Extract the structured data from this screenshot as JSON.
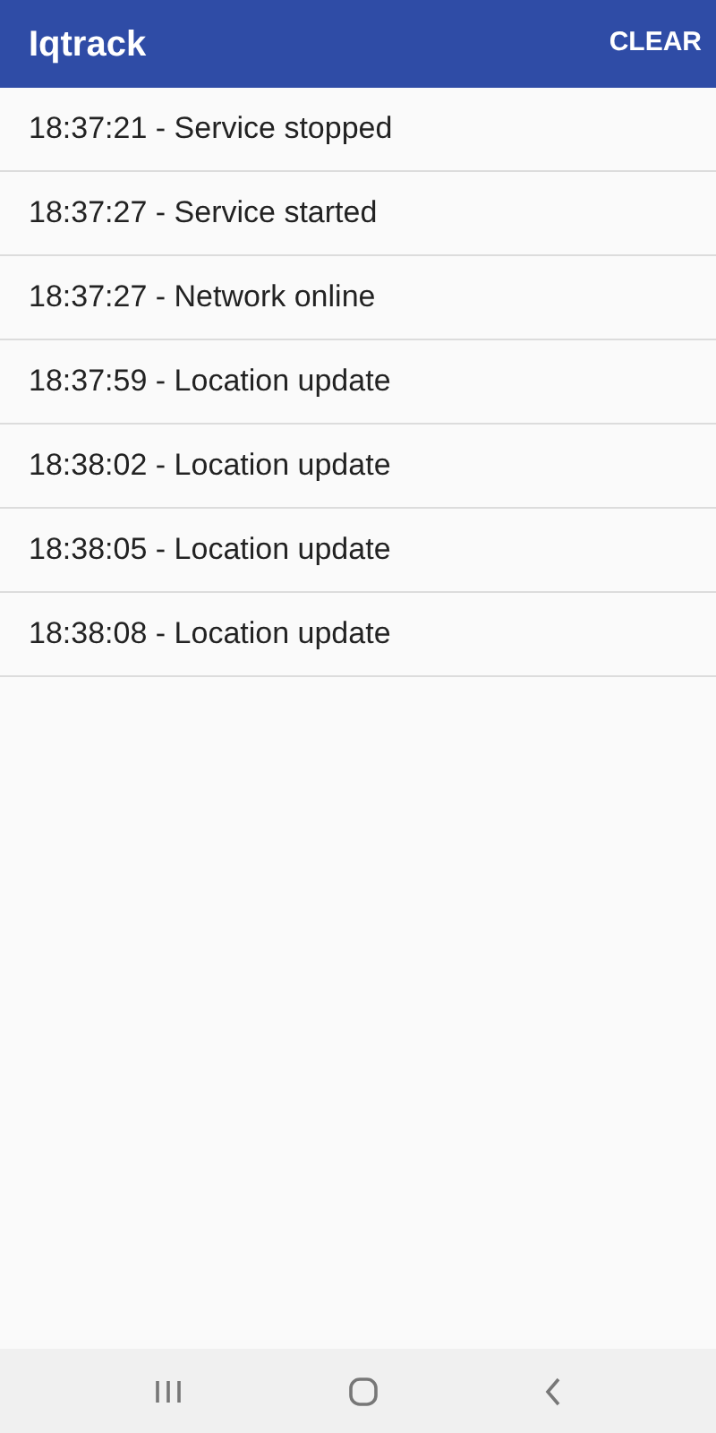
{
  "app_bar": {
    "title": "Iqtrack",
    "action": "CLEAR"
  },
  "log_entries": [
    "18:37:21 - Service stopped",
    "18:37:27 - Service started",
    "18:37:27 - Network online",
    "18:37:59 - Location update",
    "18:38:02 - Location update",
    "18:38:05 - Location update",
    "18:38:08 - Location update"
  ]
}
